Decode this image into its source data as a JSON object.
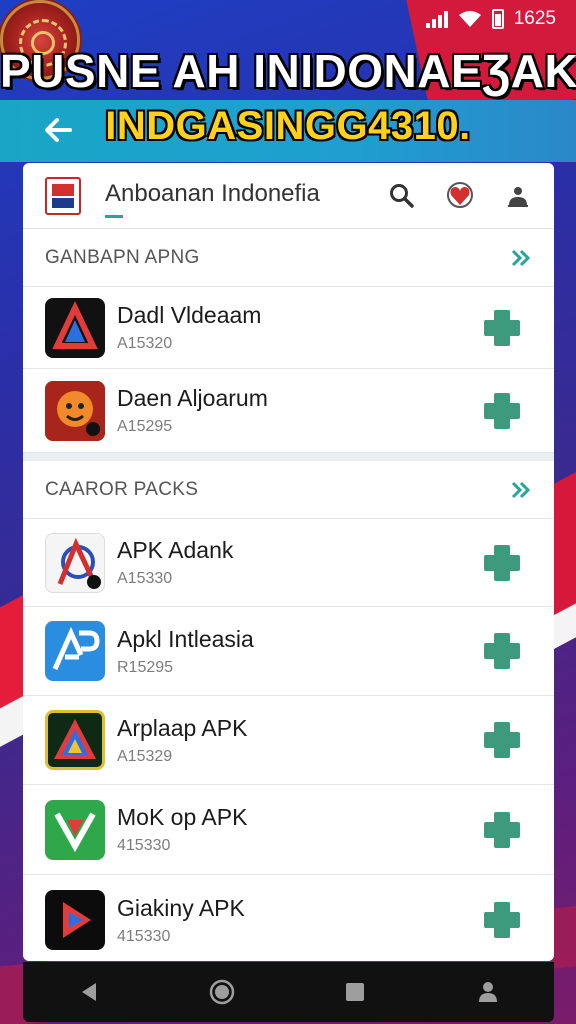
{
  "status_bar": {
    "time": "1625",
    "signal_icon": "signal-icon",
    "wifi_icon": "wifi-icon",
    "battery_icon": "battery-icon"
  },
  "header": {
    "headline": "PUSNE AH INIDONAEƷAK",
    "subheadline": "INDGASINGG4310.",
    "back_icon": "back-arrow-icon",
    "seal_icon": "seal-logo"
  },
  "search": {
    "text": "Anboanan Indonefia",
    "icons": [
      "search-icon",
      "heart-icon",
      "user-icon"
    ]
  },
  "sections": [
    {
      "title": "GANBAPN APNG",
      "items": [
        {
          "name": "Dadl Vldeaam",
          "sub": "A15320",
          "icon": "delta-app-icon"
        },
        {
          "name": "Daen Aljoarum",
          "sub": "A15295",
          "icon": "face-app-icon"
        }
      ]
    },
    {
      "title": "CAAROR PACKS",
      "items": [
        {
          "name": "APK Adank",
          "sub": "A15330",
          "icon": "k-app-icon"
        },
        {
          "name": "Apkl Intleasia",
          "sub": "R15295",
          "icon": "ap-app-icon"
        },
        {
          "name": "Arplaap APK",
          "sub": "A15329",
          "icon": "colorful-app-icon"
        },
        {
          "name": "MoK op APK",
          "sub": "415330",
          "icon": "v-app-icon"
        },
        {
          "name": "Giakiny APK",
          "sub": "415330",
          "icon": "play-app-icon"
        }
      ]
    }
  ],
  "nav": [
    "back-nav-icon",
    "home-nav-icon",
    "recents-nav-icon",
    "profile-nav-icon"
  ],
  "colors": {
    "accent": "#26a69a",
    "add_button": "#3d9a7c",
    "app_bar": "#1fa0cc",
    "headline_yellow": "#ffd21a"
  }
}
